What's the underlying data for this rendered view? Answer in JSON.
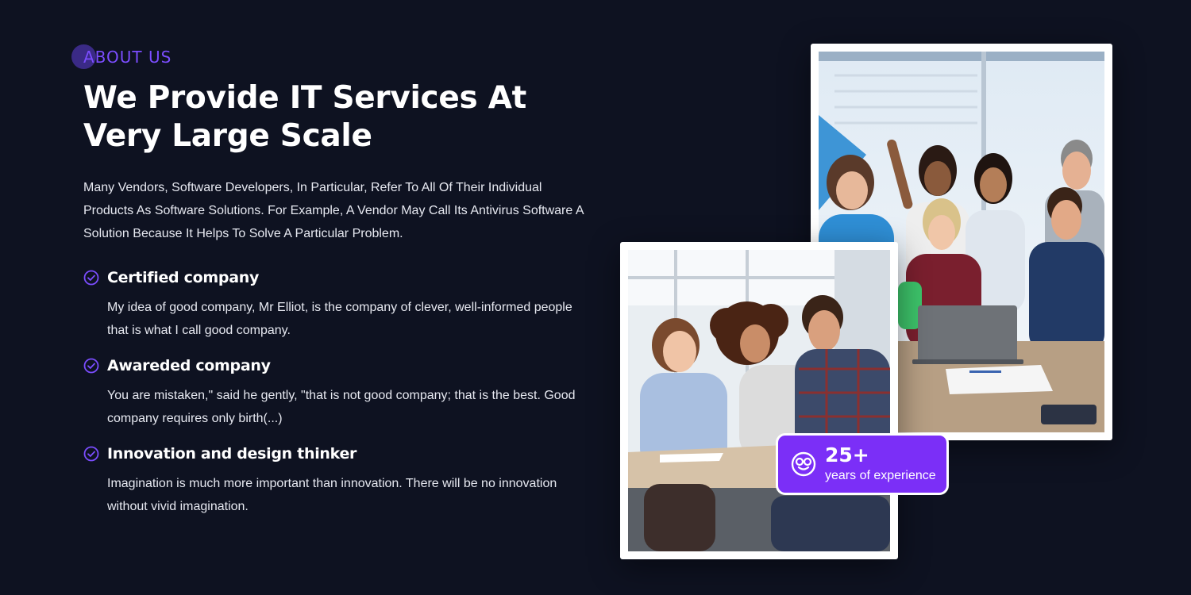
{
  "about": {
    "eyebrow": "ABOUT US",
    "title": "We Provide IT Services At Very Large Scale",
    "intro": "Many Vendors, Software Developers, In Particular, Refer To All Of Their Individual Products As Software Solutions. For Example, A Vendor May Call Its Antivirus Software A Solution Because It Helps To Solve A Particular Problem.",
    "features": [
      {
        "icon": "check-circle-icon",
        "title": "Certified company",
        "description": "My idea of good company, Mr Elliot, is the company of clever, well-informed people that is what I call good company."
      },
      {
        "icon": "check-circle-icon",
        "title": "Awareded company",
        "description": "You are mistaken,\" said he gently, \"that is not good company; that is the best. Good company requires only birth(...)"
      },
      {
        "icon": "check-circle-icon",
        "title": "Innovation and design thinker",
        "description": "Imagination is much more important than innovation. There will be no innovation without vivid imagination."
      }
    ]
  },
  "experience": {
    "icon": "smiley-glasses-icon",
    "number": "25+",
    "label": "years of experience"
  },
  "colors": {
    "background": "#0e1221",
    "accent": "#7b2ff7",
    "eyebrow": "#7b4dff",
    "text": "#ffffff"
  }
}
